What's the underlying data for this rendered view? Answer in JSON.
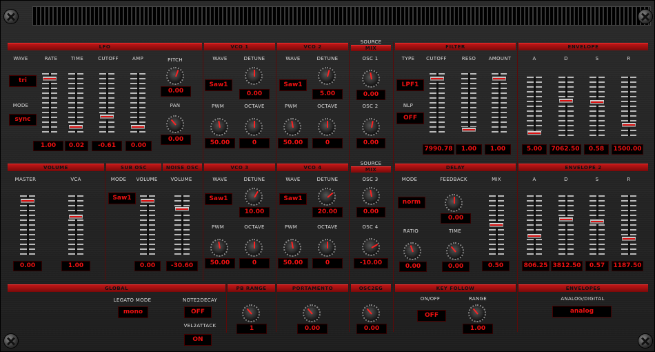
{
  "lfo": {
    "header": "LFO",
    "wave": "WAVE",
    "rate": "RATE",
    "time": "TIME",
    "cutoff": "CUTOFF",
    "amp": "AMP",
    "pitch": "PITCH",
    "pan": "PAN",
    "mode": "MODE",
    "wave_val": "tri",
    "mode_val": "sync",
    "rate_val": "1.00",
    "time_val": "0.02",
    "cutoff_val": "-0.61",
    "amp_val": "0.00",
    "pitch_val": "0.00",
    "pan_val": "0.00"
  },
  "vco1": {
    "header": "VCO 1",
    "wave": "WAVE",
    "detune": "DETUNE",
    "pwm": "PWM",
    "octave": "OCTAVE",
    "wave_val": "Saw1",
    "detune_val": "0.00",
    "pwm_val": "50.00",
    "octave_val": "0"
  },
  "vco2": {
    "header": "VCO 2",
    "wave": "WAVE",
    "detune": "DETUNE",
    "pwm": "PWM",
    "octave": "OCTAVE",
    "wave_val": "Saw1",
    "detune_val": "5.00",
    "pwm_val": "50.00",
    "octave_val": "0"
  },
  "vco3": {
    "header": "VCO 3",
    "wave": "WAVE",
    "detune": "DETUNE",
    "pwm": "PWM",
    "octave": "OCTAVE",
    "wave_val": "Saw1",
    "detune_val": "10.00",
    "pwm_val": "50.00",
    "octave_val": "0"
  },
  "vco4": {
    "header": "VCO 4",
    "wave": "WAVE",
    "detune": "DETUNE",
    "pwm": "PWM",
    "octave": "OCTAVE",
    "wave_val": "Saw1",
    "detune_val": "20.00",
    "pwm_val": "50.00",
    "octave_val": "0"
  },
  "mix1": {
    "h1": "SOURCE",
    "h2": "MIX",
    "osc1": "OSC 1",
    "osc2": "OSC 2",
    "osc1_val": "0.00",
    "osc2_val": "0.00"
  },
  "mix2": {
    "h1": "SOURCE",
    "h2": "MIX",
    "osc3": "OSC 3",
    "osc4": "OSC 4",
    "osc3_val": "0.00",
    "osc4_val": "-10.00"
  },
  "filter": {
    "header": "FILTER",
    "type": "TYPE",
    "cutoff": "CUTOFF",
    "reso": "RESO",
    "amount": "AMOUNT",
    "nlp": "NLP",
    "type_val": "LPF1",
    "nlp_val": "OFF",
    "cutoff_val": "7990.78",
    "reso_val": "1.00",
    "amount_val": "1.00"
  },
  "env1": {
    "header": "ENVELOPE",
    "a": "A",
    "d": "D",
    "s": "S",
    "r": "R",
    "a_val": "5.00",
    "d_val": "7062.50",
    "s_val": "0.58",
    "r_val": "1500.00"
  },
  "env2": {
    "header": "ENVELOPE 2",
    "a": "A",
    "d": "D",
    "s": "S",
    "r": "R",
    "a_val": "806.25",
    "d_val": "3812.50",
    "s_val": "0.57",
    "r_val": "1187.50"
  },
  "volume": {
    "header": "VOLUME",
    "master": "MASTER",
    "vca": "VCA",
    "master_val": "0.00",
    "vca_val": "1.00"
  },
  "subosc": {
    "header": "SUB OSC",
    "mode": "MODE",
    "volume": "VOLUME",
    "mode_val": "Saw1",
    "volume_val": "0.00"
  },
  "noiseosc": {
    "header": "NOISE OSC",
    "volume": "VOLUME",
    "volume_val": "-30.60"
  },
  "delay": {
    "header": "DELAY",
    "mode": "MODE",
    "feedback": "FEEDBACK",
    "mix": "MIX",
    "ratio": "RATIO",
    "time": "TIME",
    "mode_val": "norm",
    "feedback_val": "0.00",
    "ratio_val": "0.00",
    "time_val": "0.00",
    "mix_val": "0.50"
  },
  "global": {
    "header": "GLOBAL",
    "legato": "LEGATO MODE",
    "note2decay": "NOTE2DECAY",
    "vel2attack": "VEL2ATTACK",
    "legato_val": "mono",
    "note2decay_val": "OFF",
    "vel2attack_val": "ON"
  },
  "pbrange": {
    "header": "PB RANGE",
    "val": "1"
  },
  "portamento": {
    "header": "PORTAMENTO",
    "val": "0.00"
  },
  "osc2eg": {
    "header": "OSC2EG",
    "val": "0.00"
  },
  "keyfollow": {
    "header": "KEY FOLLOW",
    "onoff": "ON/OFF",
    "range": "RANGE",
    "onoff_val": "OFF",
    "range_val": "1.00"
  },
  "envelopes": {
    "header": "ENVELOPES",
    "ad": "ANALOG/DIGITAL",
    "ad_val": "analog"
  },
  "faders": {
    "lfo_rate": 0.95,
    "lfo_time": 0.05,
    "lfo_cutoff": 0.25,
    "lfo_amp": 0.05,
    "flt_cutoff": 0.95,
    "flt_reso": 0.0,
    "flt_amount": 0.95,
    "env1_a": 0.0,
    "env1_d": 0.6,
    "env1_s": 0.58,
    "env1_r": 0.15,
    "vol_master": 0.95,
    "vol_vca": 0.65,
    "sub_vol": 0.95,
    "noise_vol": 0.8,
    "dly_mix": 0.5,
    "env2_a": 0.3,
    "env2_d": 0.6,
    "env2_s": 0.57,
    "env2_r": 0.25
  },
  "colors": {
    "accent": "#c01616",
    "value": "#e11111"
  }
}
